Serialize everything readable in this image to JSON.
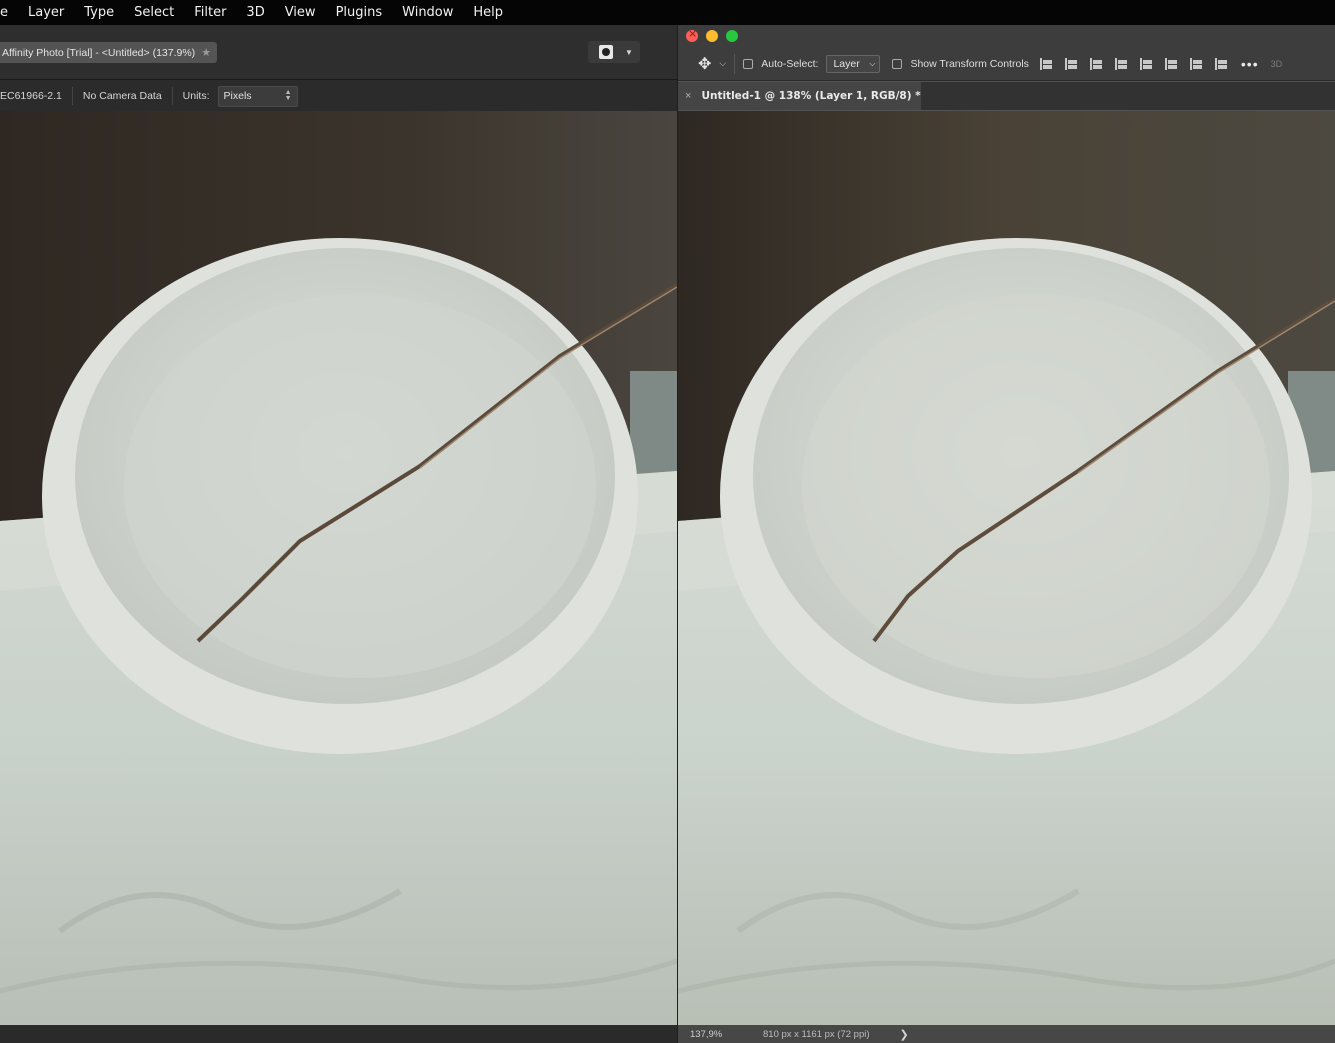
{
  "menubar": {
    "items": [
      "e",
      "Layer",
      "Type",
      "Select",
      "Filter",
      "3D",
      "View",
      "Plugins",
      "Window",
      "Help"
    ]
  },
  "affinity": {
    "doc_tab": "Affinity Photo [Trial] - <Untitled> (137.9%)",
    "close_glyph": "★",
    "context": {
      "profile": "EC61966-2.1",
      "camera": "No Camera Data",
      "units_label": "Units:",
      "units_value": "Pixels"
    }
  },
  "photoshop": {
    "options": {
      "auto_select_label": "Auto-Select:",
      "auto_select_value": "Layer",
      "show_transform_label": "Show Transform Controls",
      "more": "•••",
      "threed": "3D"
    },
    "doc_tab": "Untitled-1 @ 138% (Layer 1, RGB/8) *",
    "tab_close": "×",
    "status": {
      "zoom": "137,9%",
      "dimensions": "810 px x 1161 px (72 ppi)",
      "arrow": "❯"
    }
  },
  "colors": {
    "menubar_bg": "#050505",
    "affinity_bg": "#2b2b2b",
    "photoshop_bg": "#3d3d3d",
    "traffic_close": "#fd5e56",
    "traffic_min": "#fdbc2e",
    "traffic_max": "#27c840"
  }
}
